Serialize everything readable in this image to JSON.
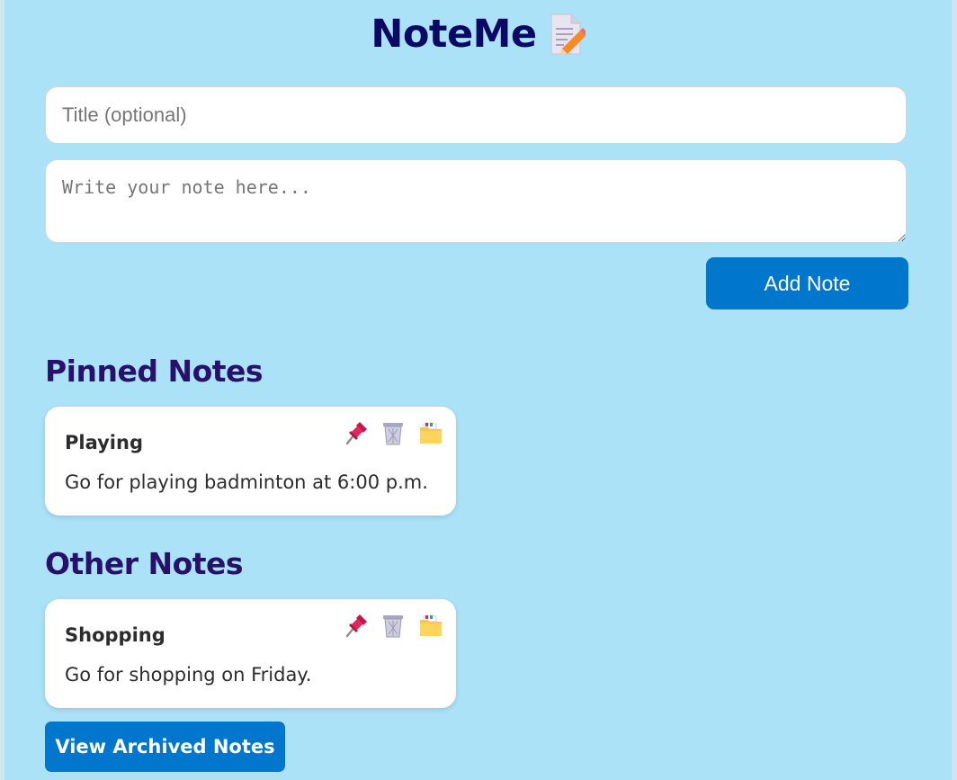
{
  "app": {
    "title": "NoteMe",
    "title_icon": "memo-icon"
  },
  "form": {
    "title_placeholder": "Title (optional)",
    "title_value": "",
    "note_placeholder": "Write your note here...",
    "note_value": "",
    "add_label": "Add Note"
  },
  "pinned": {
    "heading": "Pinned Notes",
    "notes": [
      {
        "title": "Playing",
        "content": "Go for playing badminton at 6:00 p.m."
      }
    ]
  },
  "other": {
    "heading": "Other Notes",
    "notes": [
      {
        "title": "Shopping",
        "content": "Go for shopping on Friday."
      }
    ]
  },
  "note_actions": [
    "pin-icon",
    "trash-icon",
    "archive-folder-icon"
  ],
  "archived_button_label": "View Archived Notes",
  "colors": {
    "background": "#abe2f7",
    "title": "#0b0866",
    "heading": "#27116b",
    "button": "#0077cc",
    "card": "#ffffff"
  }
}
